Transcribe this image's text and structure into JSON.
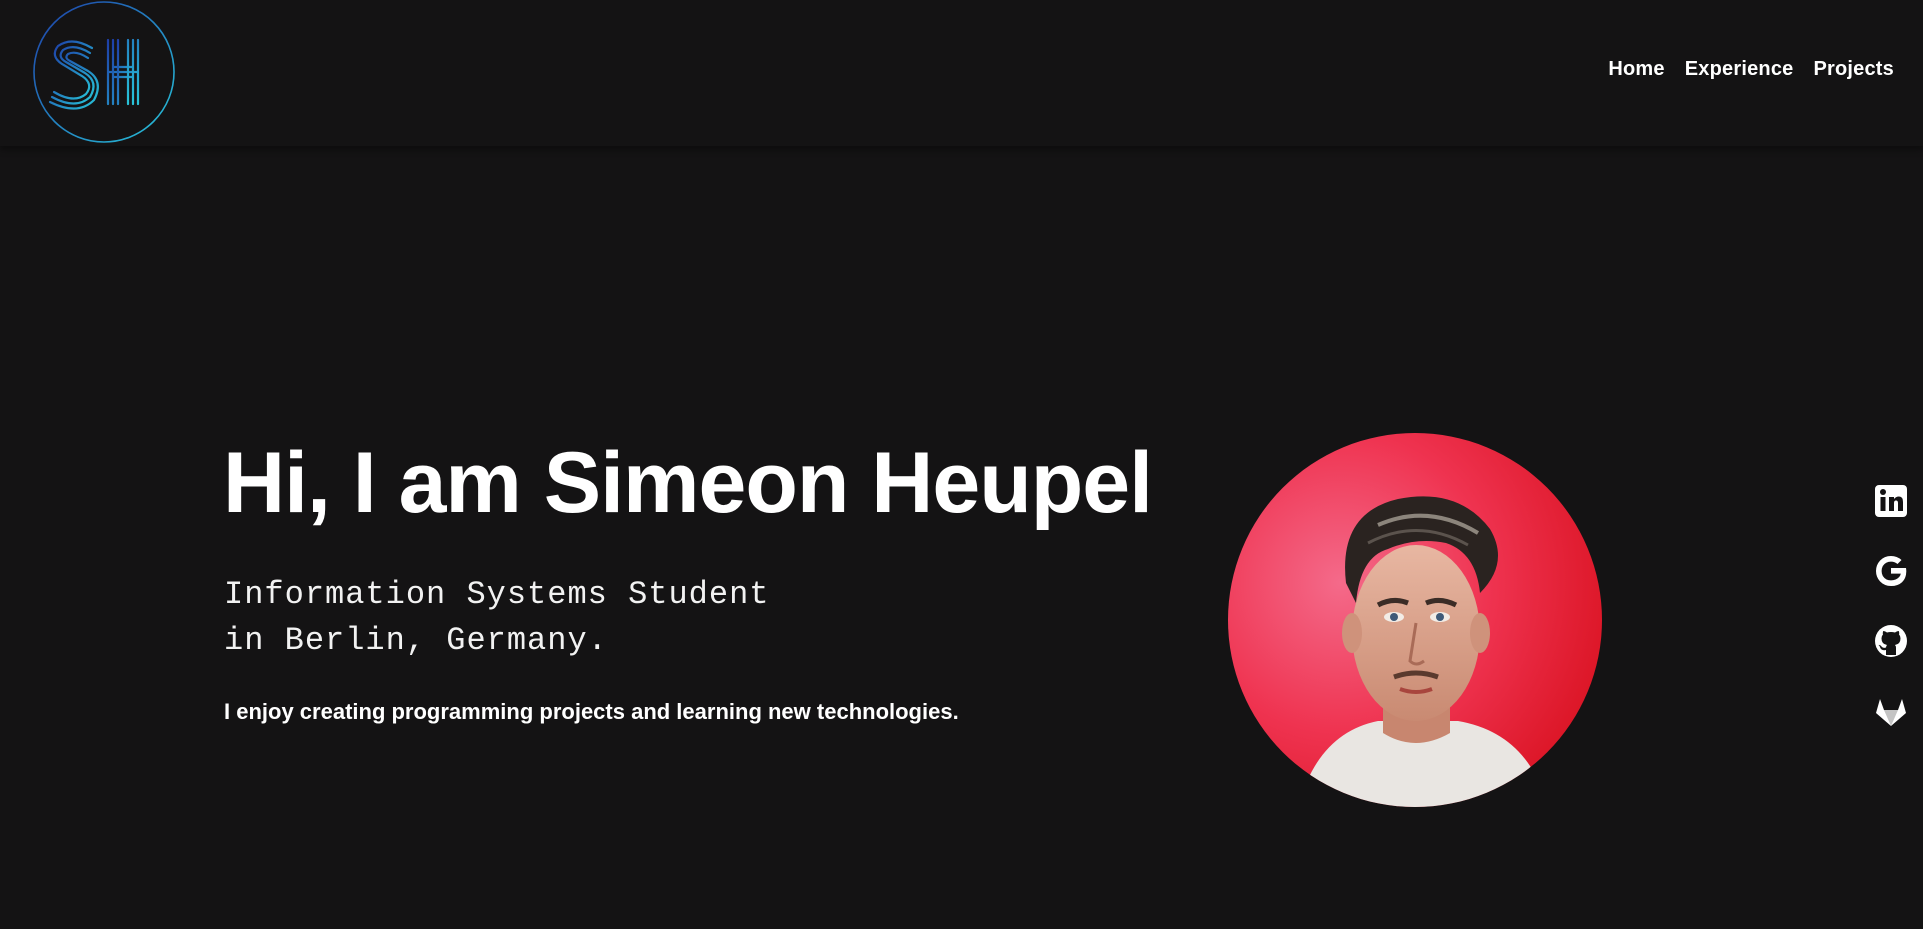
{
  "logo": {
    "text": "SH"
  },
  "nav": {
    "items": [
      {
        "label": "Home"
      },
      {
        "label": "Experience"
      },
      {
        "label": "Projects"
      }
    ]
  },
  "hero": {
    "title": "Hi, I am Simeon Heupel",
    "subtitle_line1": "Information Systems Student",
    "subtitle_line2": "in Berlin, Germany.",
    "description": "I enjoy creating programming projects and learning new technologies."
  },
  "social": {
    "icons": [
      "linkedin-icon",
      "google-icon",
      "github-icon",
      "gitlab-icon"
    ]
  },
  "colors": {
    "background": "#141314",
    "text": "#ffffff",
    "logo_accent_start": "#1e3fa8",
    "logo_accent_end": "#28c4d9",
    "portrait_bg": "#e8243a"
  }
}
